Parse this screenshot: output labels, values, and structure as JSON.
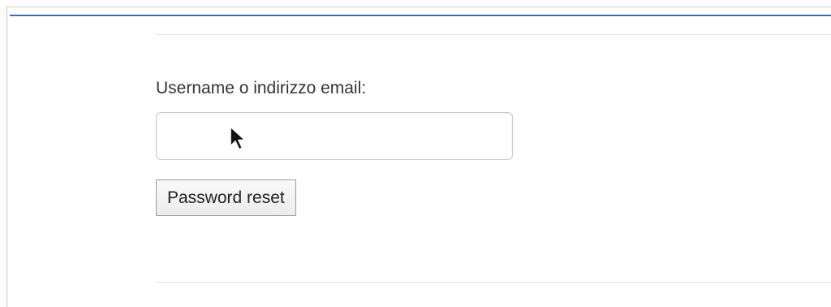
{
  "form": {
    "label": "Username o indirizzo email:",
    "input_value": "",
    "submit_label": "Password reset"
  },
  "colors": {
    "accent": "#3b6fa8",
    "label_text": "#333333",
    "border": "#c9c9c9"
  },
  "icons": {
    "pointer": "mouse-pointer-icon"
  }
}
